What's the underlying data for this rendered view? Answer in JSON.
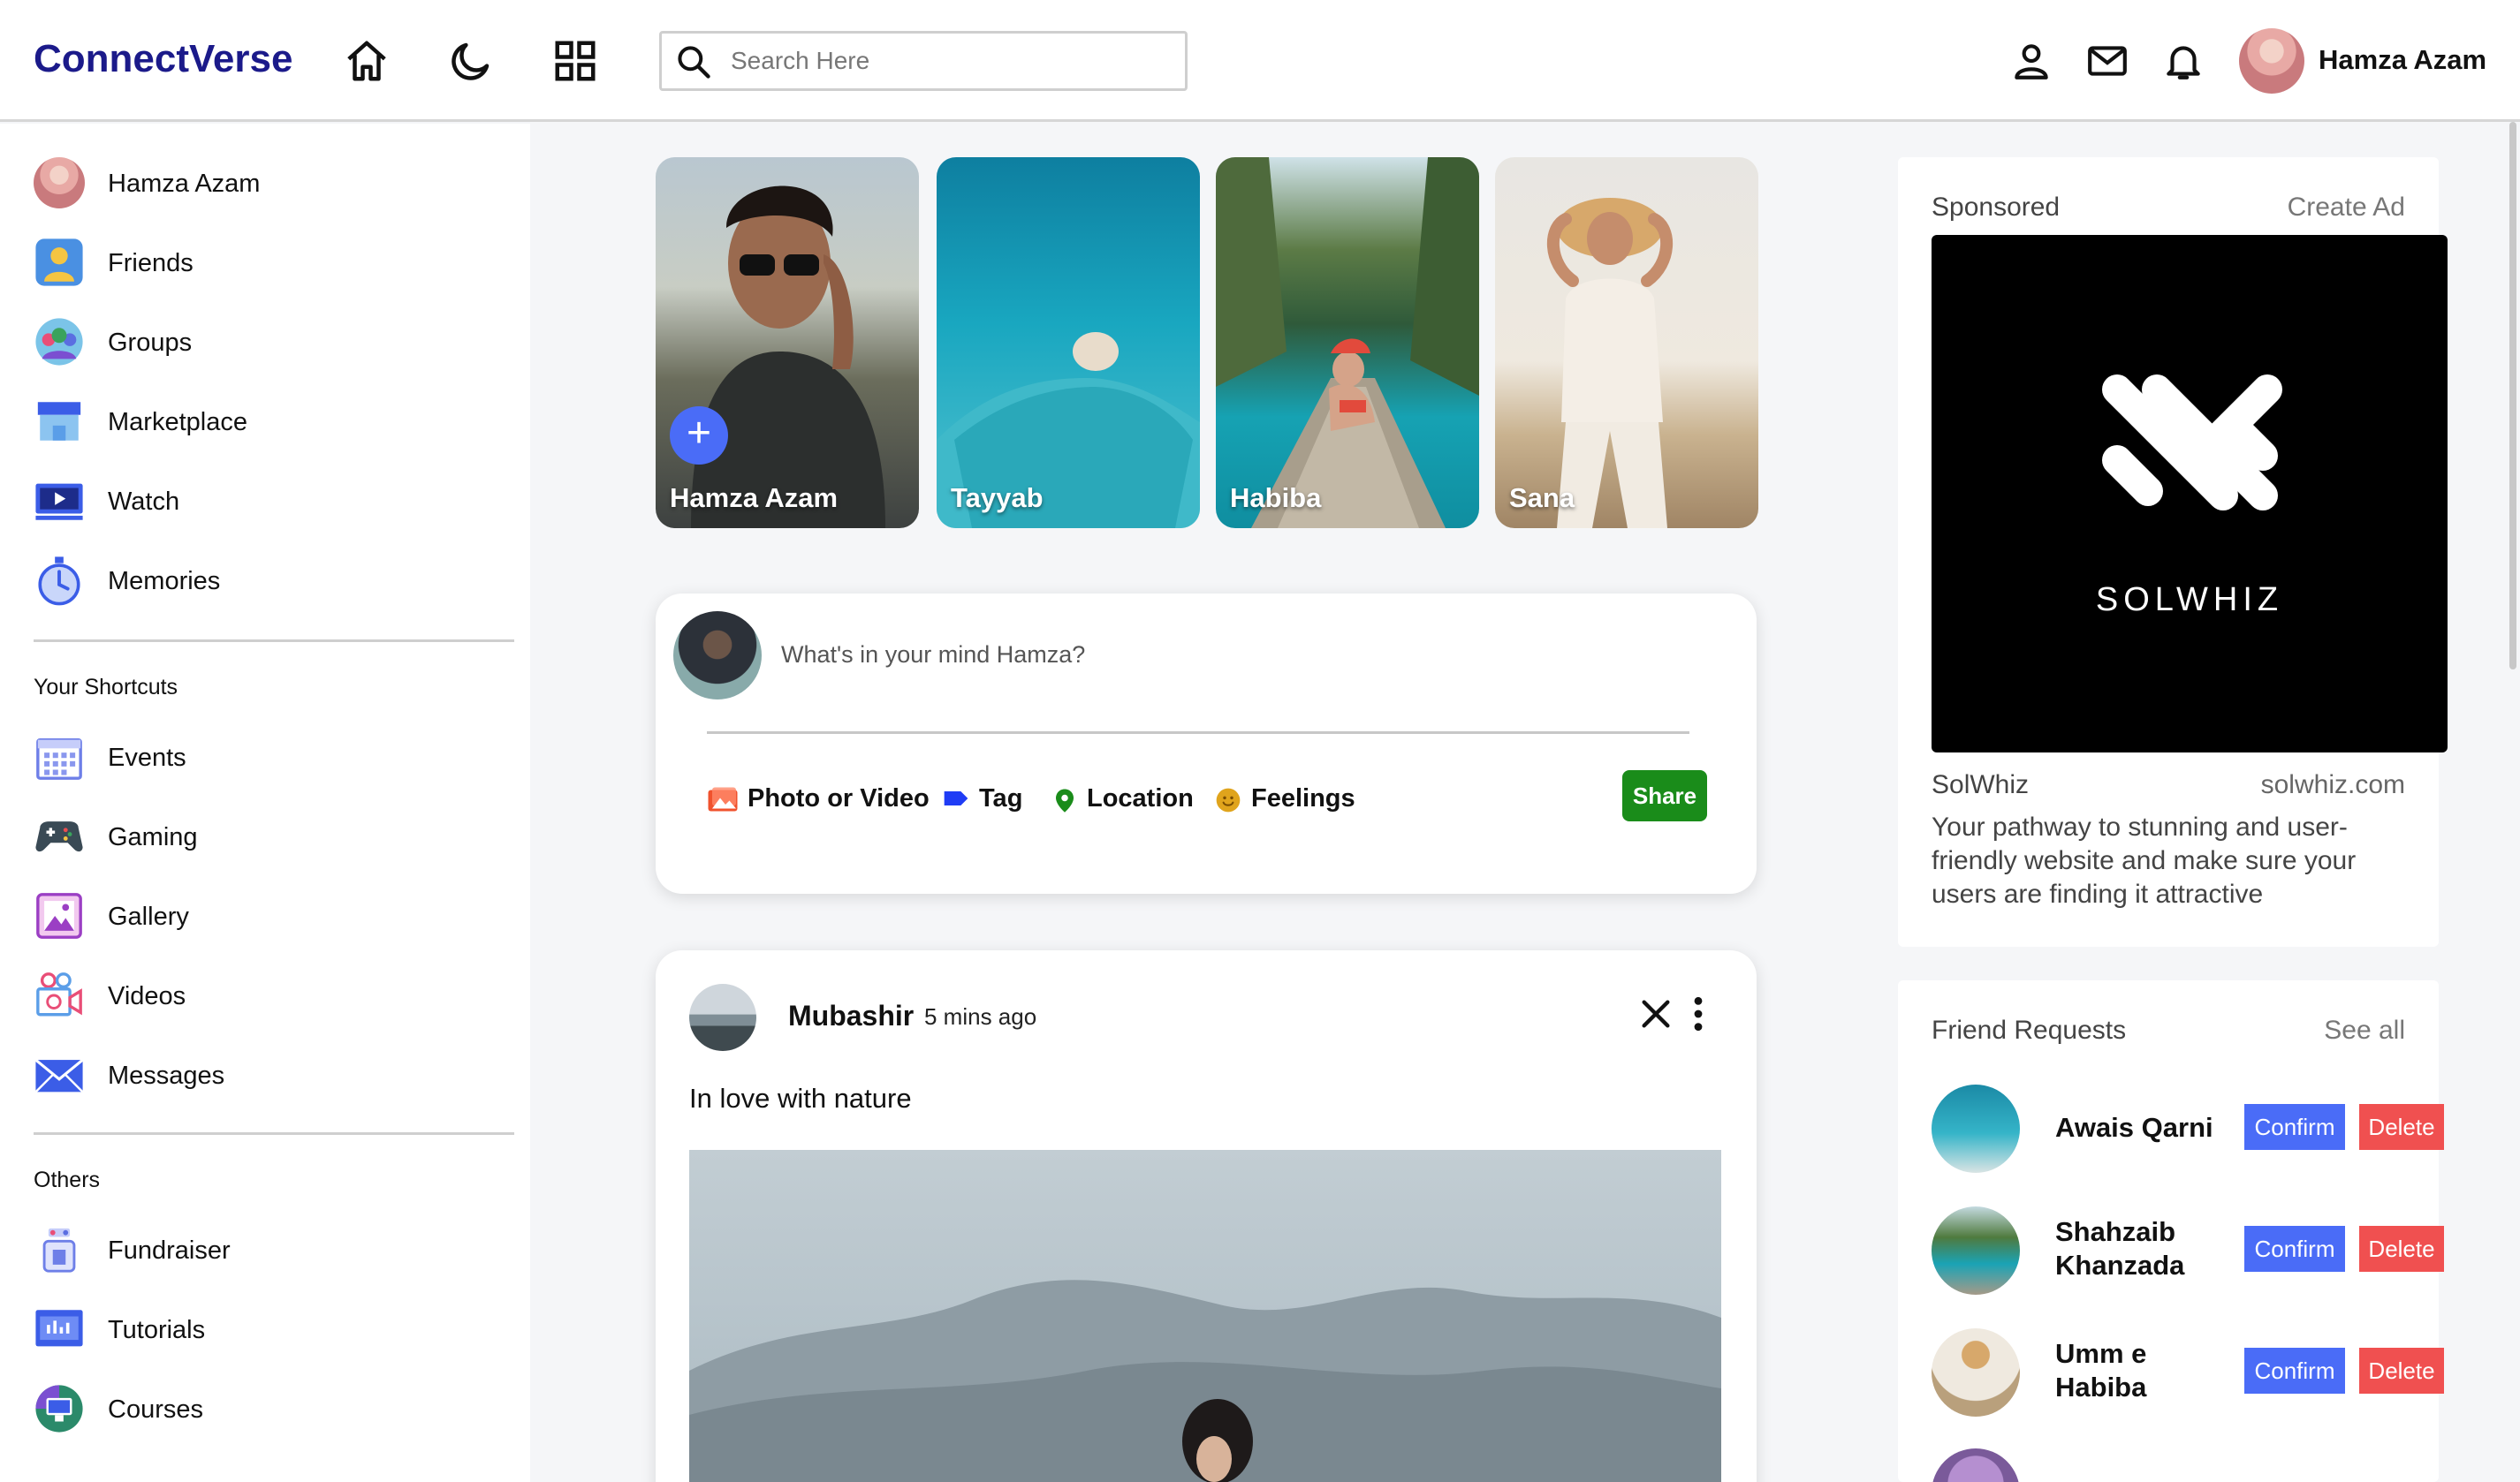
{
  "app": {
    "name": "ConnectVerse"
  },
  "search": {
    "placeholder": "Search Here"
  },
  "user": {
    "name": "Hamza Azam"
  },
  "sidebar": {
    "items": [
      {
        "label": "Hamza Azam",
        "icon": "profile-avatar"
      },
      {
        "label": "Friends",
        "icon": "friends-icon"
      },
      {
        "label": "Groups",
        "icon": "groups-icon"
      },
      {
        "label": "Marketplace",
        "icon": "marketplace-icon"
      },
      {
        "label": "Watch",
        "icon": "watch-icon"
      },
      {
        "label": "Memories",
        "icon": "memories-icon"
      }
    ],
    "shortcuts_title": "Your Shortcuts",
    "shortcuts": [
      {
        "label": "Events",
        "icon": "calendar-icon"
      },
      {
        "label": "Gaming",
        "icon": "gamepad-icon"
      },
      {
        "label": "Gallery",
        "icon": "gallery-icon"
      },
      {
        "label": "Videos",
        "icon": "video-camera-icon"
      },
      {
        "label": "Messages",
        "icon": "envelope-icon"
      }
    ],
    "others_title": "Others",
    "others": [
      {
        "label": "Fundraiser",
        "icon": "fundraiser-icon"
      },
      {
        "label": "Tutorials",
        "icon": "tutorials-icon"
      },
      {
        "label": "Courses",
        "icon": "courses-icon"
      }
    ]
  },
  "stories": [
    {
      "name": "Hamza Azam",
      "own": true
    },
    {
      "name": "Tayyab"
    },
    {
      "name": "Habiba"
    },
    {
      "name": "Sana"
    }
  ],
  "composer": {
    "placeholder": "What's in your mind Hamza?",
    "options": [
      {
        "label": "Photo or Video",
        "icon": "photo-icon",
        "color": "#f0522d"
      },
      {
        "label": "Tag",
        "icon": "tag-icon",
        "color": "#1f3cf5"
      },
      {
        "label": "Location",
        "icon": "location-pin-icon",
        "color": "#1a8c1a"
      },
      {
        "label": "Feelings",
        "icon": "smiley-icon",
        "color": "#e0a41c"
      }
    ],
    "share_label": "Share",
    "share_color": "#1a8c1a"
  },
  "post": {
    "author": "Mubashir",
    "time": "5 mins ago",
    "text": "In love with nature"
  },
  "sponsored": {
    "title": "Sponsored",
    "create_label": "Create Ad",
    "brand_logo_text": "SOLWHIZ",
    "ad_name": "SolWhiz",
    "ad_url": "solwhiz.com",
    "ad_description": "Your pathway to stunning and user-friendly website and make sure your users are finding it attractive"
  },
  "friend_requests": {
    "title": "Friend Requests",
    "see_all_label": "See all",
    "confirm_label": "Confirm",
    "delete_label": "Delete",
    "items": [
      {
        "name": "Awais Qarni"
      },
      {
        "name": "Shahzaib Khanzada"
      },
      {
        "name": "Umm e Habiba"
      }
    ]
  },
  "colors": {
    "brand": "#1b1a8a",
    "accent": "#4a6cf7",
    "delete": "#f05050"
  }
}
